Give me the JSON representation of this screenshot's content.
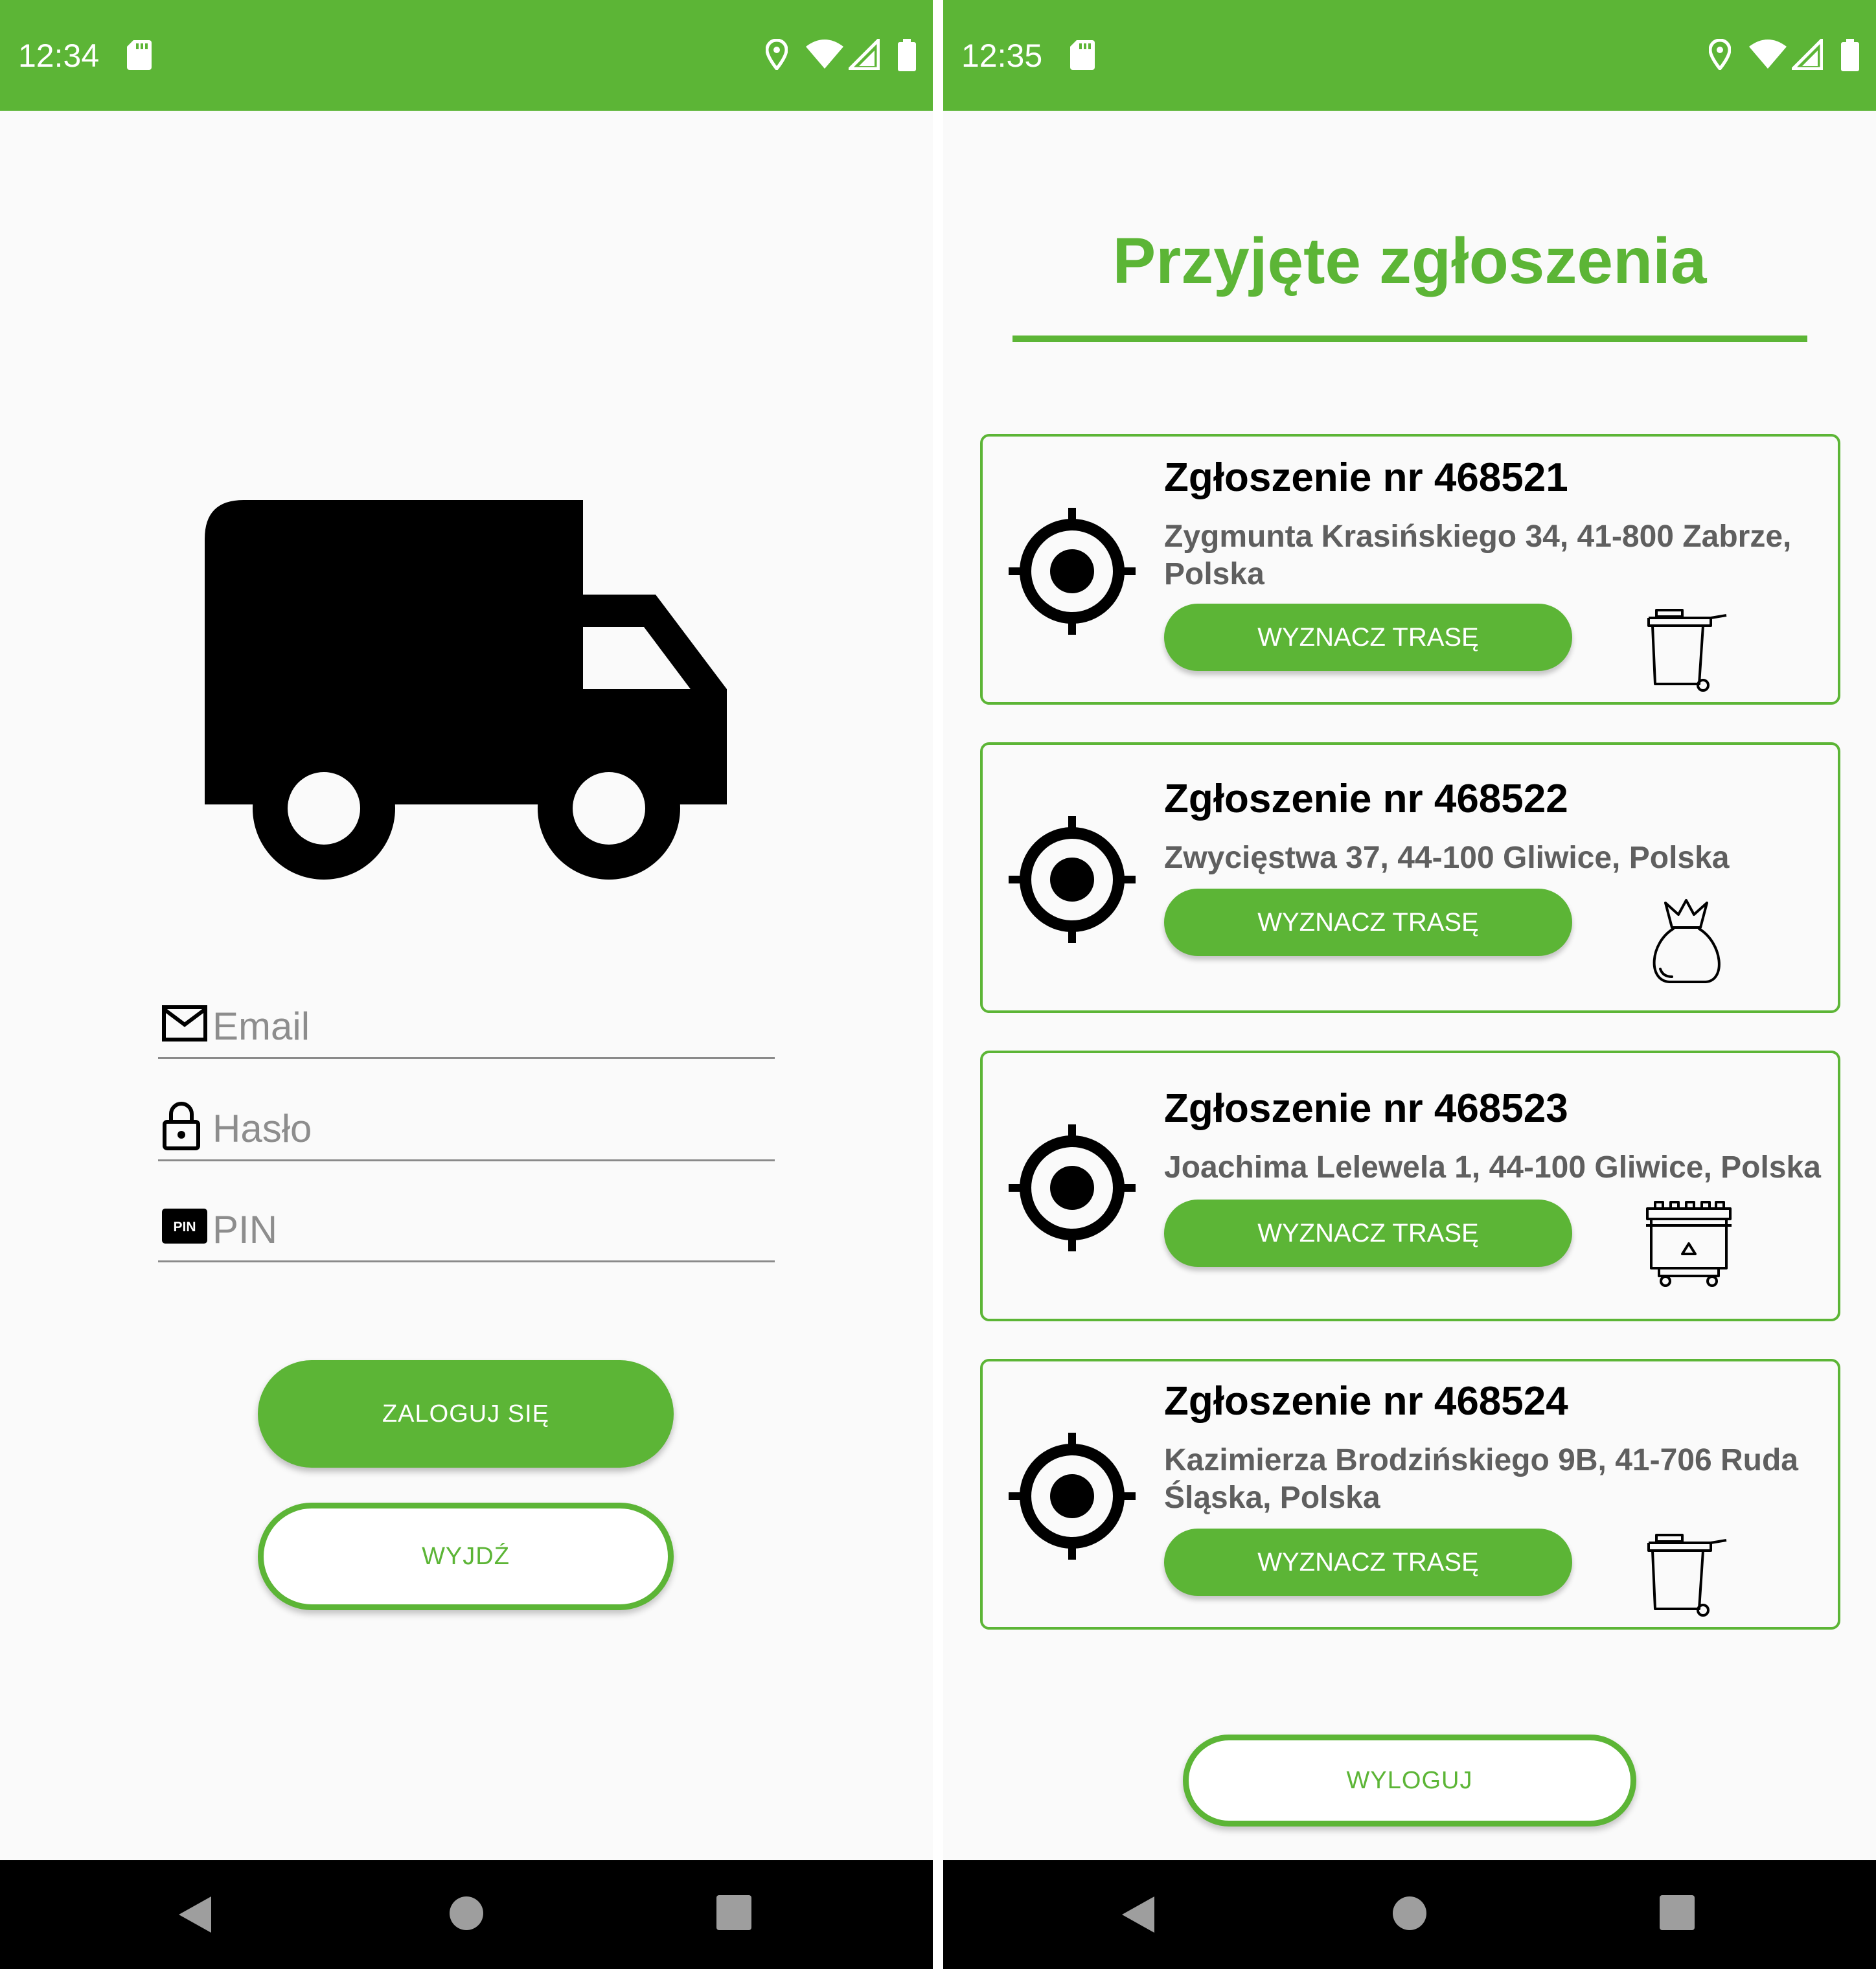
{
  "colors": {
    "accent": "#5cb536",
    "navbar": "#000000",
    "background": "#fafafa"
  },
  "login_screen": {
    "status_bar": {
      "time": "12:34",
      "icons": [
        "sd-card-icon",
        "location-icon",
        "wifi-icon",
        "signal-icon",
        "battery-icon"
      ]
    },
    "logo_icon": "truck-icon",
    "email": {
      "placeholder": "Email",
      "icon": "mail-icon"
    },
    "password": {
      "placeholder": "Hasło",
      "icon": "lock-icon"
    },
    "pin": {
      "placeholder": "PIN",
      "icon": "pin-icon",
      "icon_text": "PIN"
    },
    "login_button": "ZALOGUJ SIĘ",
    "exit_button": "WYJDŹ",
    "nav": [
      "back-icon",
      "home-icon",
      "recents-icon"
    ]
  },
  "reports_screen": {
    "status_bar": {
      "time": "12:35",
      "icons": [
        "sd-card-icon",
        "location-icon",
        "wifi-icon",
        "signal-icon",
        "battery-icon"
      ]
    },
    "title": "Przyjęte zgłoszenia",
    "reports": [
      {
        "title": "Zgłoszenie nr 468521",
        "address": "Zygmunta Krasińskiego 34, 41-800 Zabrze, Polska",
        "button": "WYZNACZ TRASĘ",
        "bin_icon": "wheelie-bin-icon"
      },
      {
        "title": "Zgłoszenie nr 468522",
        "address": "Zwycięstwa 37, 44-100 Gliwice, Polska",
        "button": "WYZNACZ TRASĘ",
        "bin_icon": "trash-bag-icon"
      },
      {
        "title": "Zgłoszenie nr 468523",
        "address": "Joachima Lelewela 1, 44-100 Gliwice, Polska",
        "button": "WYZNACZ TRASĘ",
        "bin_icon": "recycling-container-icon"
      },
      {
        "title": "Zgłoszenie nr 468524",
        "address": "Kazimierza Brodzińskiego 9B, 41-706 Ruda Śląska, Polska",
        "button": "WYZNACZ TRASĘ",
        "bin_icon": "wheelie-bin-icon"
      }
    ],
    "logout_button": "WYLOGUJ",
    "nav": [
      "back-icon",
      "home-icon",
      "recents-icon"
    ]
  }
}
